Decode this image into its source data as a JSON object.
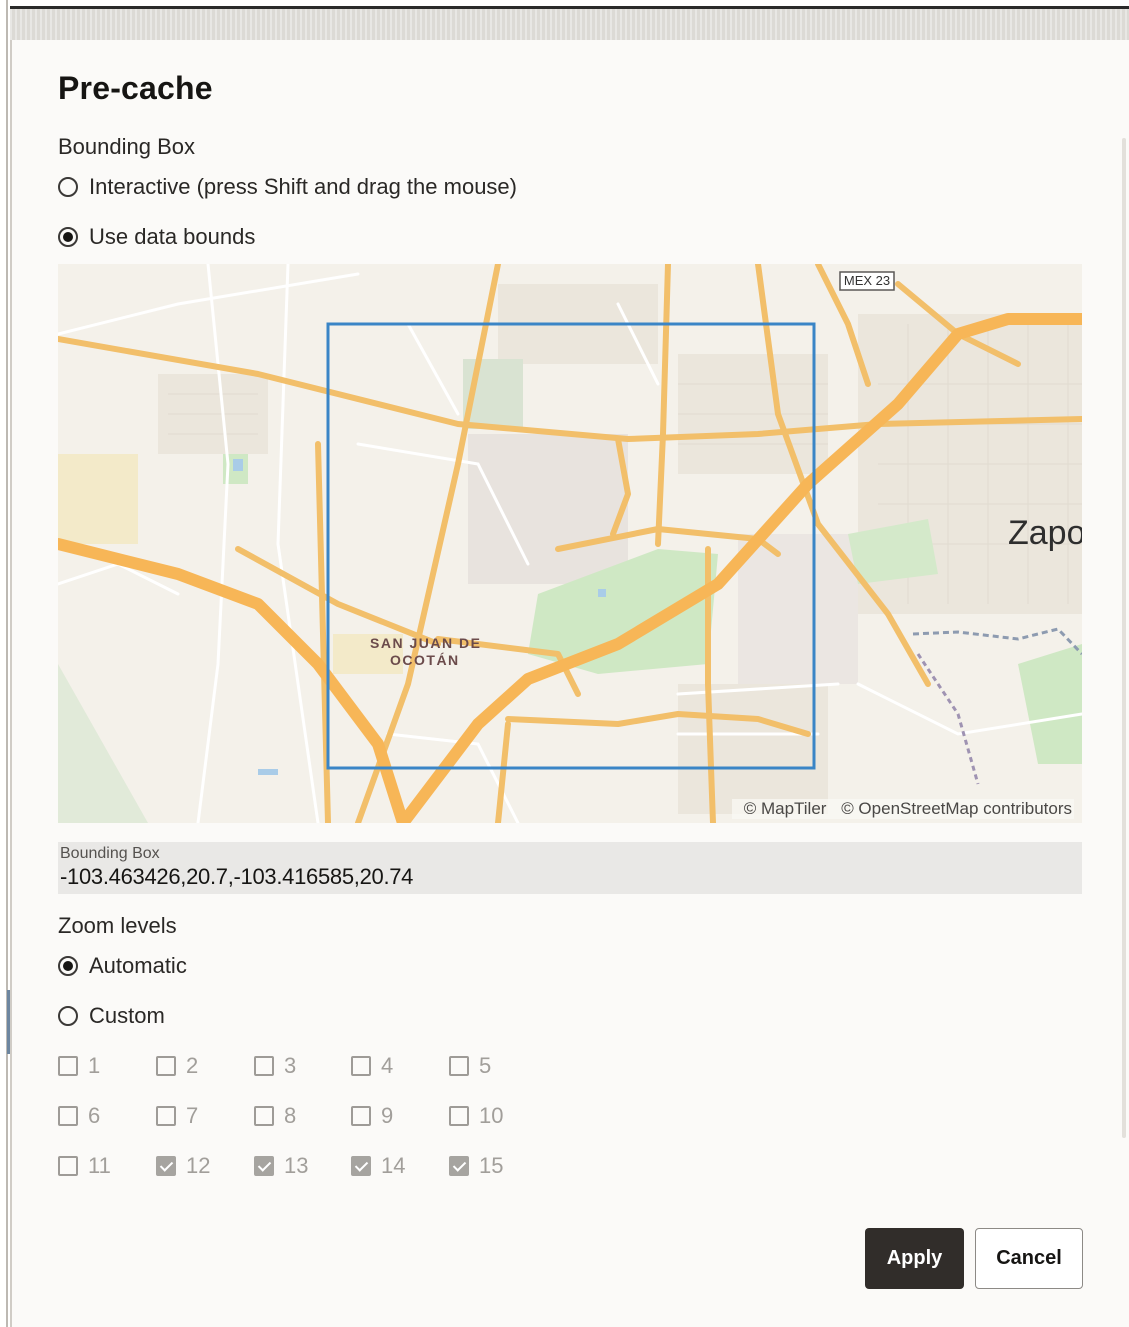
{
  "dialog": {
    "title": "Pre-cache"
  },
  "bounding_box_section": {
    "label": "Bounding Box",
    "options": [
      {
        "label": "Interactive (press Shift and drag the mouse)",
        "selected": false
      },
      {
        "label": "Use data bounds",
        "selected": true
      }
    ]
  },
  "map": {
    "shield_label": "MEX 23",
    "place_label_line1": "SAN JUAN DE",
    "place_label_line2": "OCOTÁN",
    "city_label": "Zapo",
    "attribution": [
      "© MapTiler",
      "© OpenStreetMap contributors"
    ],
    "selection_color": "#3a85c6"
  },
  "bbox_field": {
    "label": "Bounding Box",
    "value": "-103.463426,20.7,-103.416585,20.74"
  },
  "zoom_section": {
    "label": "Zoom levels",
    "options": [
      {
        "label": "Automatic",
        "selected": true
      },
      {
        "label": "Custom",
        "selected": false
      }
    ],
    "levels": [
      {
        "label": "1",
        "checked": false
      },
      {
        "label": "2",
        "checked": false
      },
      {
        "label": "3",
        "checked": false
      },
      {
        "label": "4",
        "checked": false
      },
      {
        "label": "5",
        "checked": false
      },
      {
        "label": "6",
        "checked": false
      },
      {
        "label": "7",
        "checked": false
      },
      {
        "label": "8",
        "checked": false
      },
      {
        "label": "9",
        "checked": false
      },
      {
        "label": "10",
        "checked": false
      },
      {
        "label": "11",
        "checked": false
      },
      {
        "label": "12",
        "checked": true
      },
      {
        "label": "13",
        "checked": true
      },
      {
        "label": "14",
        "checked": true
      },
      {
        "label": "15",
        "checked": true
      }
    ]
  },
  "buttons": {
    "apply": "Apply",
    "cancel": "Cancel"
  },
  "colors": {
    "primary_button": "#312d2a",
    "road_major": "#f7c66b",
    "park": "#cfe8c4"
  }
}
